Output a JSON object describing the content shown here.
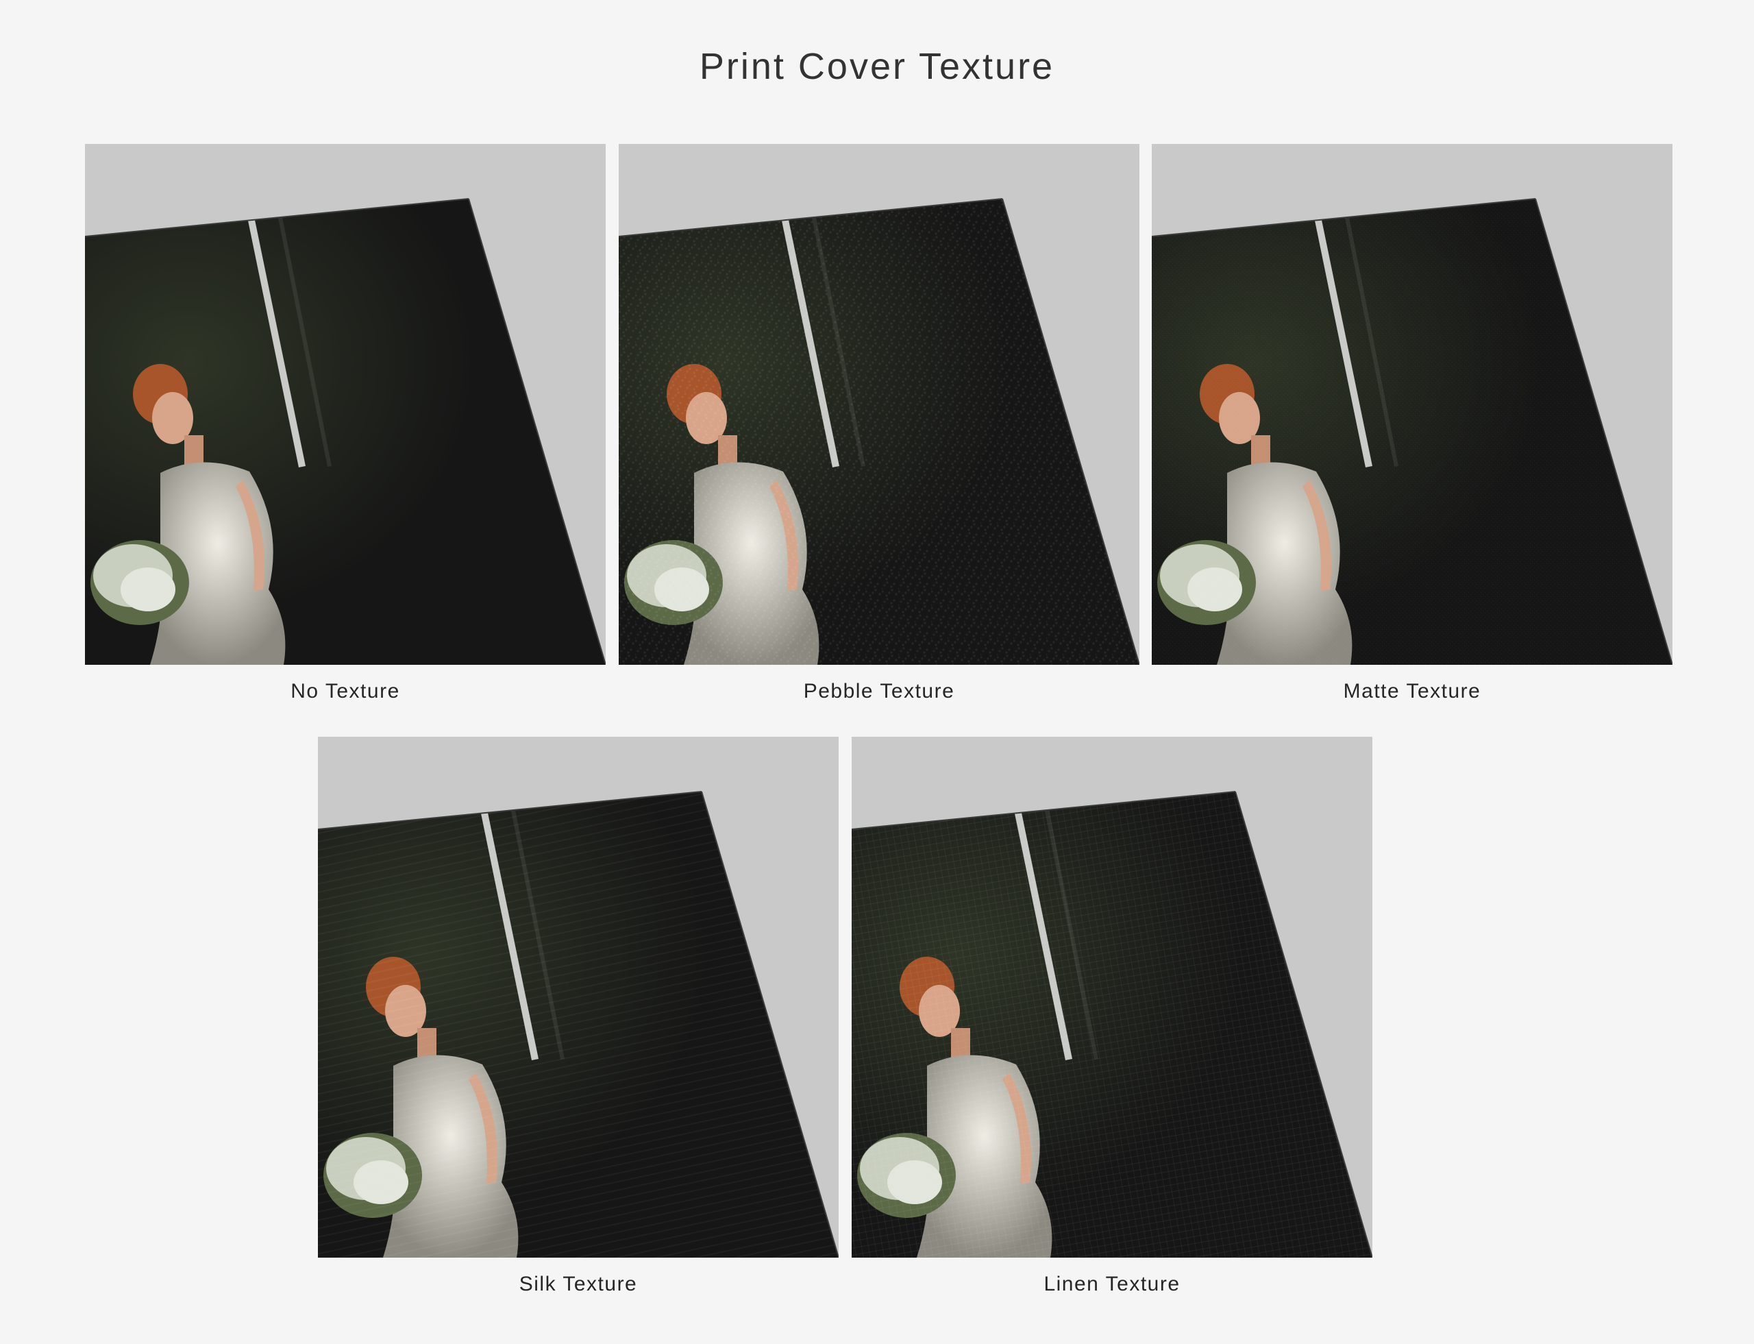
{
  "page": {
    "title": "Print Cover Texture"
  },
  "colors": {
    "background": "#f5f5f5",
    "photo_backdrop": "#c9c9c9",
    "cover": "#161616"
  },
  "textures": [
    {
      "id": "no",
      "label": "No Texture",
      "pattern": "none"
    },
    {
      "id": "pebble",
      "label": "Pebble Texture",
      "pattern": "pebble"
    },
    {
      "id": "matte",
      "label": "Matte Texture",
      "pattern": "matte"
    },
    {
      "id": "silk",
      "label": "Silk Texture",
      "pattern": "silk"
    },
    {
      "id": "linen",
      "label": "Linen Texture",
      "pattern": "linen"
    }
  ]
}
